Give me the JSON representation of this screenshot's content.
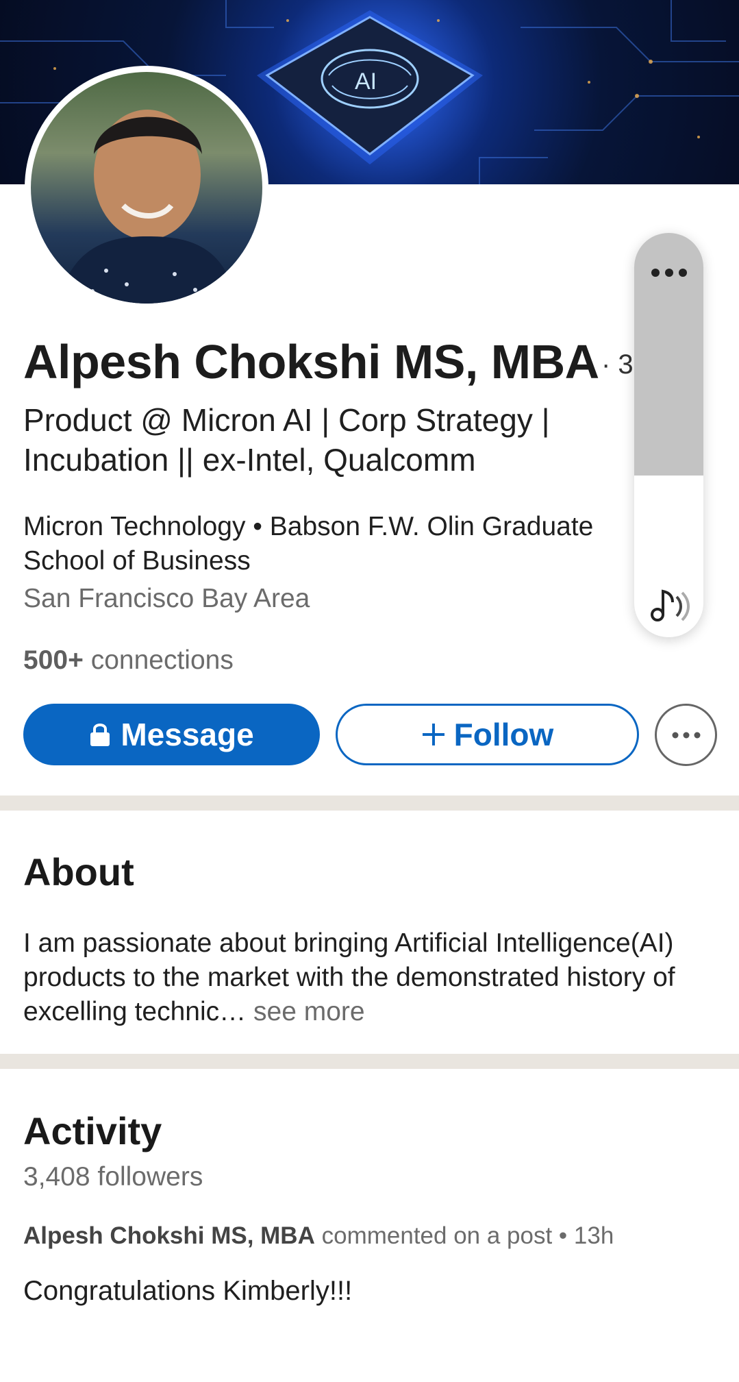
{
  "profile": {
    "name": "Alpesh Chokshi MS, MBA",
    "degree": "· 3",
    "headline": "Product @ Micron AI | Corp Strategy | Incubation || ex-Intel, Qualcomm",
    "education": "Micron Technology • Babson F.W. Olin Graduate School of Business",
    "location": "San Francisco Bay Area",
    "connections_count": "500+",
    "connections_label": "connections",
    "banner_chip_text": "AI"
  },
  "actions": {
    "message_label": "Message",
    "follow_label": "Follow",
    "more_icon": "ellipsis-icon"
  },
  "about": {
    "title": "About",
    "text": "I am passionate about bringing Artificial Intelligence(AI) products to the market with the demonstrated history of excelling technic…",
    "see_more": "see more"
  },
  "activity": {
    "title": "Activity",
    "followers": "3,408 followers",
    "author": "Alpesh Chokshi MS, MBA",
    "action": "commented on a post • 13h",
    "post_text": "Congratulations Kimberly!!!"
  },
  "volume_overlay": {
    "menu_icon": "ellipsis-icon",
    "speaker_icon": "media-volume-icon",
    "level": 0.4
  },
  "colors": {
    "brand_blue": "#0a66c2",
    "divider": "#e9e5df",
    "muted_text": "#6b6b6b"
  }
}
